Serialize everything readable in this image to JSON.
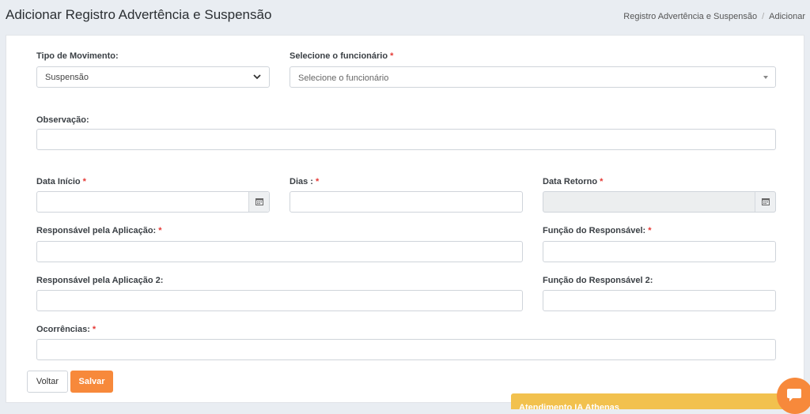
{
  "header": {
    "title": "Adicionar Registro Advertência e Suspensão",
    "breadcrumb": [
      "Registro Advertência e Suspensão",
      "Adicionar"
    ],
    "breadcrumb_separator": "/"
  },
  "form": {
    "tipo_movimento": {
      "label": "Tipo de Movimento:",
      "value": "Suspensão"
    },
    "funcionario": {
      "label": "Selecione o funcionário",
      "required": "*",
      "placeholder": "Selecione o funcionário"
    },
    "observacao": {
      "label": "Observação:",
      "value": ""
    },
    "data_inicio": {
      "label": "Data Início",
      "required": "*",
      "value": ""
    },
    "dias": {
      "label": "Dias :",
      "required": "*",
      "value": ""
    },
    "data_retorno": {
      "label": "Data Retorno",
      "required": "*",
      "value": ""
    },
    "responsavel": {
      "label": "Responsável pela Aplicação:",
      "required": "*",
      "value": ""
    },
    "funcao_responsavel": {
      "label": "Função do Responsável:",
      "required": "*",
      "value": ""
    },
    "responsavel2": {
      "label": "Responsável pela Aplicação 2:",
      "value": ""
    },
    "funcao_responsavel2": {
      "label": "Função do Responsável 2:",
      "value": ""
    },
    "ocorrencias": {
      "label": "Ocorrências:",
      "required": "*",
      "value": ""
    }
  },
  "actions": {
    "back_label": "Voltar",
    "save_label": "Salvar"
  },
  "chat": {
    "label": "Atendimento IA Athenas"
  },
  "colors": {
    "accent": "#f7893b",
    "chat": "#f2c14e",
    "required": "#e53935",
    "background": "#e9edf2"
  }
}
